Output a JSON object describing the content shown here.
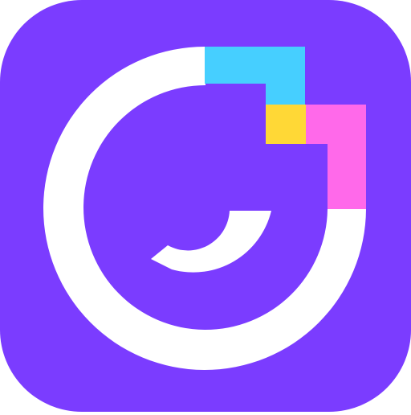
{
  "icon": {
    "colors": {
      "background": "#7b3cff",
      "ring": "#ffffff",
      "cyan": "#46cfff",
      "yellow": "#ffd836",
      "pink": "#ff69ea"
    }
  }
}
